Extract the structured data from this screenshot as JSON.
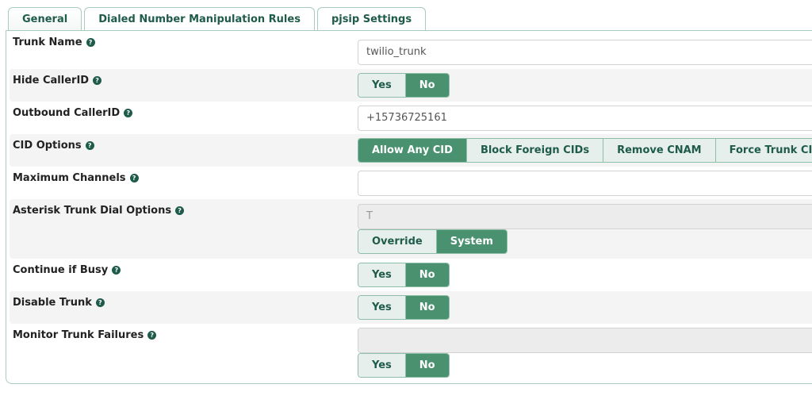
{
  "tabs": [
    {
      "label": "General",
      "active": true
    },
    {
      "label": "Dialed Number Manipulation Rules",
      "active": false
    },
    {
      "label": "pjsip Settings",
      "active": false
    }
  ],
  "help_glyph": "?",
  "fields": {
    "trunk_name": {
      "label": "Trunk Name",
      "value": "twilio_trunk"
    },
    "hide_callerid": {
      "label": "Hide CallerID",
      "options": [
        "Yes",
        "No"
      ],
      "selected": "No"
    },
    "outbound_callerid": {
      "label": "Outbound CallerID",
      "value": "+15736725161"
    },
    "cid_options": {
      "label": "CID Options",
      "options": [
        "Allow Any CID",
        "Block Foreign CIDs",
        "Remove CNAM",
        "Force Trunk CID"
      ],
      "selected": "Allow Any CID"
    },
    "max_channels": {
      "label": "Maximum Channels",
      "value": ""
    },
    "dial_options": {
      "label": "Asterisk Trunk Dial Options",
      "value": "T",
      "options": [
        "Override",
        "System"
      ],
      "selected": "System"
    },
    "continue_if_busy": {
      "label": "Continue if Busy",
      "options": [
        "Yes",
        "No"
      ],
      "selected": "No"
    },
    "disable_trunk": {
      "label": "Disable Trunk",
      "options": [
        "Yes",
        "No"
      ],
      "selected": "No"
    },
    "monitor_failures": {
      "label": "Monitor Trunk Failures",
      "value": "",
      "options": [
        "Yes",
        "No"
      ],
      "selected": "No"
    }
  }
}
